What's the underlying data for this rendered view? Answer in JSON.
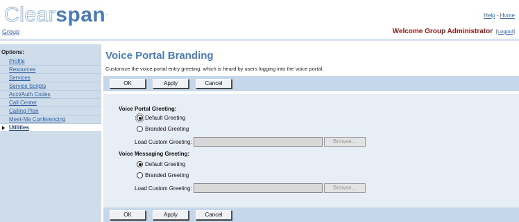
{
  "brand": {
    "logo_light": "Clear",
    "logo_bold": "span",
    "logo_mark": "°"
  },
  "header": {
    "help": "Help",
    "sep": " - ",
    "home": "Home",
    "group": "Group",
    "welcome": "Welcome Group Administrator",
    "logout": "[Logout]"
  },
  "sidebar": {
    "title": "Options:",
    "items": [
      {
        "label": "Profile"
      },
      {
        "label": "Resources"
      },
      {
        "label": "Services"
      },
      {
        "label": "Service Scripts"
      },
      {
        "label": "Acct/Auth Codes"
      },
      {
        "label": "Call Center"
      },
      {
        "label": "Calling Plan"
      },
      {
        "label": "Meet-Me Conferencing"
      },
      {
        "label": "Utilities",
        "active": true
      }
    ]
  },
  "main": {
    "title": "Voice Portal Branding",
    "description": "Customize the voice portal entry greeting, which is heard by users logging into the voice portal.",
    "buttons": {
      "ok": "OK",
      "apply": "Apply",
      "cancel": "Cancel"
    },
    "voice_portal": {
      "label": "Voice Portal Greeting:",
      "options": [
        "Default Greeting",
        "Branded Greeting"
      ],
      "selected": "Default Greeting",
      "load_label": "Load Custom Greeting:",
      "file_value": "",
      "browse": "Browse..."
    },
    "voice_messaging": {
      "label": "Voice Messaging Greeting:",
      "options": [
        "Default Greeting",
        "Branded Greeting"
      ],
      "selected": "Default Greeting",
      "load_label": "Load Custom Greeting:",
      "file_value": "",
      "browse": "Browse..."
    }
  },
  "colors": {
    "accent": "#4a7bb3",
    "welcome": "#8b1a1a",
    "sidebar_bg": "#cfdcea",
    "bar_bg": "#c5d7ea",
    "panel_bg": "#e8eef6"
  }
}
